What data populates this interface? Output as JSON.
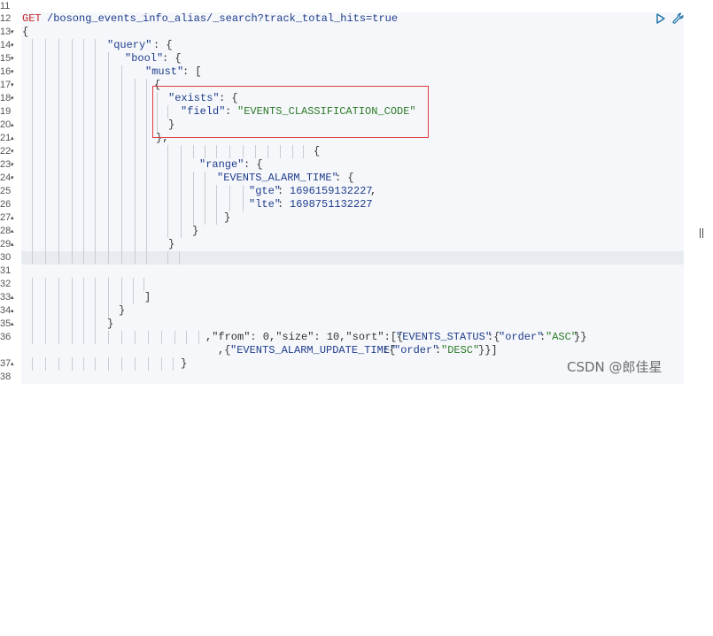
{
  "request": {
    "method": "GET",
    "url": "/bosong_events_info_alias/_search?track_total_hits=true"
  },
  "gutter": {
    "line_numbers": [
      "11",
      "12",
      "13",
      "14",
      "15",
      "16",
      "17",
      "18",
      "19",
      "20",
      "21",
      "22",
      "23",
      "24",
      "25",
      "26",
      "27",
      "28",
      "29",
      "30",
      "31",
      "32",
      "33",
      "34",
      "35",
      "36",
      "",
      "37",
      "38"
    ]
  },
  "code": {
    "open_brace": "{",
    "query_key": "\"query\"",
    "bool_key": "\"bool\"",
    "must_key": "\"must\"",
    "exists_key": "\"exists\"",
    "field_key": "\"field\"",
    "field_value": "\"EVENTS_CLASSIFICATION_CODE\"",
    "range_key": "\"range\"",
    "alarm_time_key": "\"EVENTS_ALARM_TIME\"",
    "gte_key": "\"gte\"",
    "gte_value": "1696159132227",
    "lte_key": "\"lte\"",
    "lte_value": "1698751132227",
    "line36_prefix": ",\"from\": 0,\"size\": 10,\"sort\":[{",
    "status_key": "\"EVENTS_STATUS\"",
    "order_key": "\"order\"",
    "asc_value": "\"ASC\"",
    "line36_suffix": "}}",
    "update_time_key": "\"EVENTS_ALARM_UPDATE_TIME\"",
    "desc_value": "\"DESC\"",
    "cont_suffix": "}}]"
  },
  "watermark": "CSDN @郎佳星",
  "icons": {
    "run": "play-triangle-icon",
    "settings": "wrench-icon"
  },
  "colors": {
    "method": "#c1272d",
    "key": "#1f3d8c",
    "string": "#2d7a28",
    "highlight_border": "#e13a3a"
  }
}
